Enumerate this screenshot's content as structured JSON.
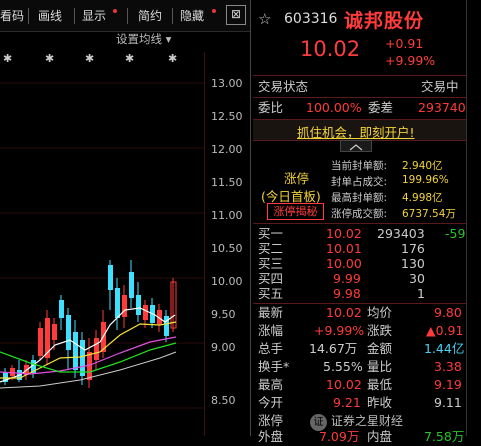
{
  "toolbar": {
    "left_partial": "看码",
    "huixian": "画线",
    "xianshi": "显示",
    "jianyue": "简约",
    "yincang": "隐藏",
    "close_glyph": "⊠"
  },
  "chart": {
    "settings_label": "设置均线",
    "settings_arrow": "▾",
    "col_marker": "✱",
    "y_ticks": [
      "13.00",
      "12.50",
      "12.00",
      "11.50",
      "11.00",
      "10.50",
      "10.00",
      "9.50",
      "9.00",
      "8.50"
    ],
    "colors": {
      "up": "#ff3b3b",
      "down": "#3fe0ff",
      "ma_white": "#ffffff",
      "ma_yellow": "#f5e23c",
      "ma_magenta": "#e050e0",
      "ma_green": "#20e020"
    },
    "watermark_logo": "证",
    "watermark": "证券之星财经"
  },
  "header": {
    "star": "☆",
    "code": "603316",
    "name": "诚邦股份",
    "price": "10.02",
    "change": "+0.91",
    "pct": "+9.99%"
  },
  "status": {
    "label": "交易状态",
    "value": "交易中"
  },
  "weibi": {
    "label": "委比",
    "value": "100.00%",
    "label2": "委差",
    "value2": "293740"
  },
  "promo": "抓住机会，即刻开户!",
  "limit": {
    "badge_top": "涨停",
    "badge_mid": "(今日首板)",
    "badge_btn": "涨停揭秘",
    "rows": [
      {
        "label": "当前封单额:",
        "value": "2.940亿"
      },
      {
        "label": "封单占成交:",
        "value": "199.96%"
      },
      {
        "label": "最高封单额:",
        "value": "4.998亿"
      },
      {
        "label": "涨停成交额:",
        "value": "6737.54万"
      }
    ]
  },
  "order_book": [
    {
      "label": "买一",
      "price": "10.02",
      "vol": "293403",
      "chg": "-59"
    },
    {
      "label": "买二",
      "price": "10.01",
      "vol": "176",
      "chg": ""
    },
    {
      "label": "买三",
      "price": "10.00",
      "vol": "130",
      "chg": ""
    },
    {
      "label": "买四",
      "price": "9.99",
      "vol": "30",
      "chg": ""
    },
    {
      "label": "买五",
      "price": "9.98",
      "vol": "1",
      "chg": ""
    }
  ],
  "stats": [
    {
      "l1": "最新",
      "v1": "10.02",
      "l2": "均价",
      "v2": "9.80"
    },
    {
      "l1": "涨幅",
      "v1": "+9.99%",
      "l2": "涨跌",
      "v2": "▲0.91"
    },
    {
      "l1": "总手",
      "v1": "14.67万",
      "l2": "金额",
      "v2": "1.44亿"
    },
    {
      "l1": "换手*",
      "v1": "5.55%",
      "l2": "量比",
      "v2": "3.38"
    },
    {
      "l1": "最高",
      "v1": "10.02",
      "l2": "最低",
      "v2": "9.19"
    },
    {
      "l1": "今开",
      "v1": "9.21",
      "l2": "昨收",
      "v2": "9.11"
    },
    {
      "l1": "涨停",
      "v1": "",
      "l2": "",
      "v2": ""
    },
    {
      "l1": "外盘",
      "v1": "7.09万",
      "l2": "内盘",
      "v2": "7.58万"
    }
  ]
}
